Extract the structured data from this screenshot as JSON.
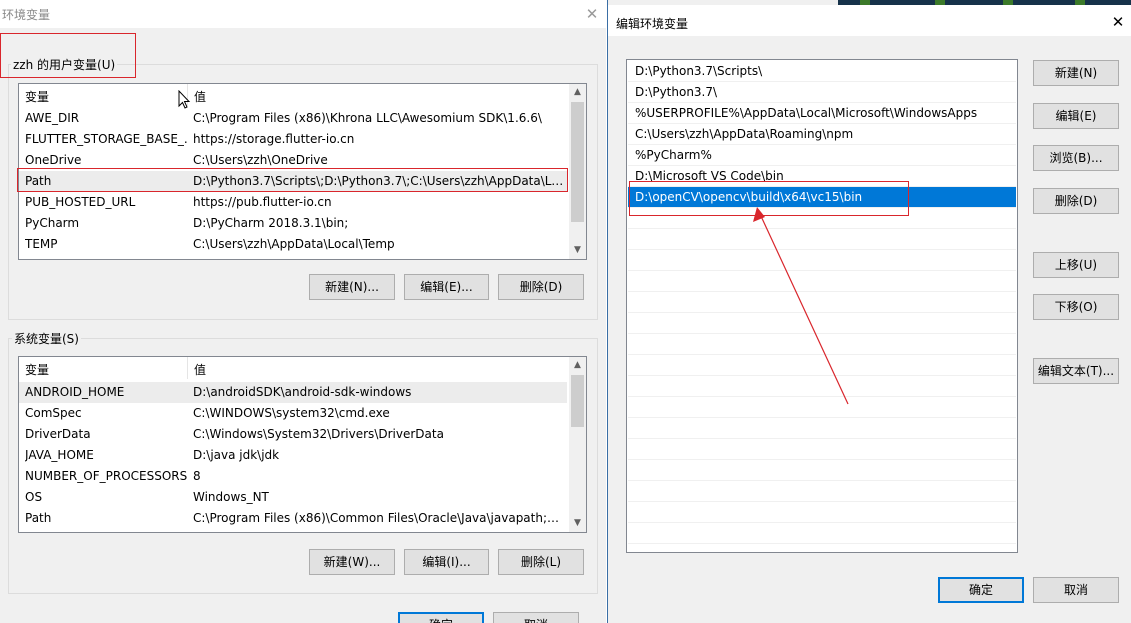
{
  "left_window": {
    "title": "环境变量",
    "user_section": {
      "label": "zzh 的用户变量(U)",
      "col_var": "变量",
      "col_val": "值",
      "rows": [
        {
          "name": "AWE_DIR",
          "value": "C:\\Program Files (x86)\\Khrona LLC\\Awesomium SDK\\1.6.6\\"
        },
        {
          "name": "FLUTTER_STORAGE_BASE_...",
          "value": "https://storage.flutter-io.cn"
        },
        {
          "name": "OneDrive",
          "value": "C:\\Users\\zzh\\OneDrive"
        },
        {
          "name": "Path",
          "value": "D:\\Python3.7\\Scripts\\;D:\\Python3.7\\;C:\\Users\\zzh\\AppData\\Lo..."
        },
        {
          "name": "PUB_HOSTED_URL",
          "value": "https://pub.flutter-io.cn"
        },
        {
          "name": "PyCharm",
          "value": "D:\\PyCharm 2018.3.1\\bin;"
        },
        {
          "name": "TEMP",
          "value": "C:\\Users\\zzh\\AppData\\Local\\Temp"
        }
      ],
      "selected_index": 3,
      "buttons": {
        "new": "新建(N)...",
        "edit": "编辑(E)...",
        "delete": "删除(D)"
      }
    },
    "system_section": {
      "label": "系统变量(S)",
      "col_var": "变量",
      "col_val": "值",
      "rows": [
        {
          "name": "ANDROID_HOME",
          "value": "D:\\androidSDK\\android-sdk-windows"
        },
        {
          "name": "ComSpec",
          "value": "C:\\WINDOWS\\system32\\cmd.exe"
        },
        {
          "name": "DriverData",
          "value": "C:\\Windows\\System32\\Drivers\\DriverData"
        },
        {
          "name": "JAVA_HOME",
          "value": "D:\\java jdk\\jdk"
        },
        {
          "name": "NUMBER_OF_PROCESSORS",
          "value": "8"
        },
        {
          "name": "OS",
          "value": "Windows_NT"
        },
        {
          "name": "Path",
          "value": "C:\\Program Files (x86)\\Common Files\\Oracle\\Java\\javapath;C:..."
        }
      ],
      "selected_index": 0,
      "buttons": {
        "new": "新建(W)...",
        "edit": "编辑(I)...",
        "delete": "删除(L)"
      }
    },
    "bottom_buttons": {
      "ok": "确定",
      "cancel": "取消"
    }
  },
  "right_window": {
    "title": "编辑环境变量",
    "entries": [
      "D:\\Python3.7\\Scripts\\",
      "D:\\Python3.7\\",
      "%USERPROFILE%\\AppData\\Local\\Microsoft\\WindowsApps",
      "C:\\Users\\zzh\\AppData\\Roaming\\npm",
      "%PyCharm%",
      "D:\\Microsoft VS Code\\bin",
      "D:\\openCV\\opencv\\build\\x64\\vc15\\bin"
    ],
    "selected_index": 6,
    "side_buttons": {
      "new": "新建(N)",
      "edit": "编辑(E)",
      "browse": "浏览(B)...",
      "delete": "删除(D)",
      "move_up": "上移(U)",
      "move_down": "下移(O)",
      "edit_text": "编辑文本(T)..."
    },
    "ok": "确定",
    "cancel": "取消"
  },
  "colors": {
    "selection_blue": "#0078d7",
    "annotation_red": "#d9262c",
    "dialog_bg": "#f0f0f0"
  }
}
